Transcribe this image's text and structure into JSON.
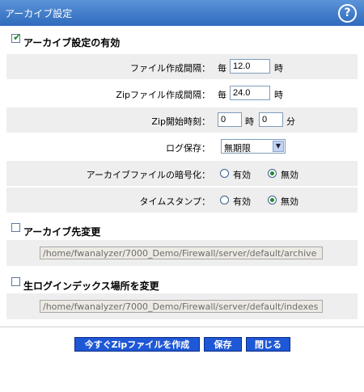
{
  "header": {
    "title": "アーカイブ設定",
    "help_symbol": "?"
  },
  "archive": {
    "enable_label": "アーカイブ設定の有効",
    "enable_checked": true,
    "file_interval": {
      "label": "ファイル作成間隔：",
      "prefix": "毎",
      "value": "12.0",
      "unit": "時"
    },
    "zip_interval": {
      "label": "Zipファイル作成間隔：",
      "prefix": "毎",
      "value": "24.0",
      "unit": "時"
    },
    "zip_start": {
      "label": "Zip開始時刻：",
      "hour_value": "0",
      "hour_unit": "時",
      "minute_value": "0",
      "minute_unit": "分"
    },
    "log_retention": {
      "label": "ログ保存：",
      "selected": "無期限"
    },
    "encryption": {
      "label": "アーカイブファイルの暗号化：",
      "opt_enable": "有効",
      "opt_disable": "無効",
      "selected": "disable"
    },
    "timestamp": {
      "label": "タイムスタンプ：",
      "opt_enable": "有効",
      "opt_disable": "無効",
      "selected": "disable"
    }
  },
  "dest": {
    "label": "アーカイブ先変更",
    "checked": false,
    "path": "/home/fwanalyzer/7000_Demo/Firewall/server/default/archive"
  },
  "index": {
    "label": "生ログインデックス場所を変更",
    "checked": false,
    "path": "/home/fwanalyzer/7000_Demo/Firewall/server/default/indexes"
  },
  "footer": {
    "create_zip_label": "今すぐZipファイルを作成",
    "save_label": "保存",
    "close_label": "閉じる"
  },
  "colors": {
    "title_bar": "#2f6bbd",
    "button": "#1f58d6",
    "radio_selected": "#1c8a2e"
  }
}
